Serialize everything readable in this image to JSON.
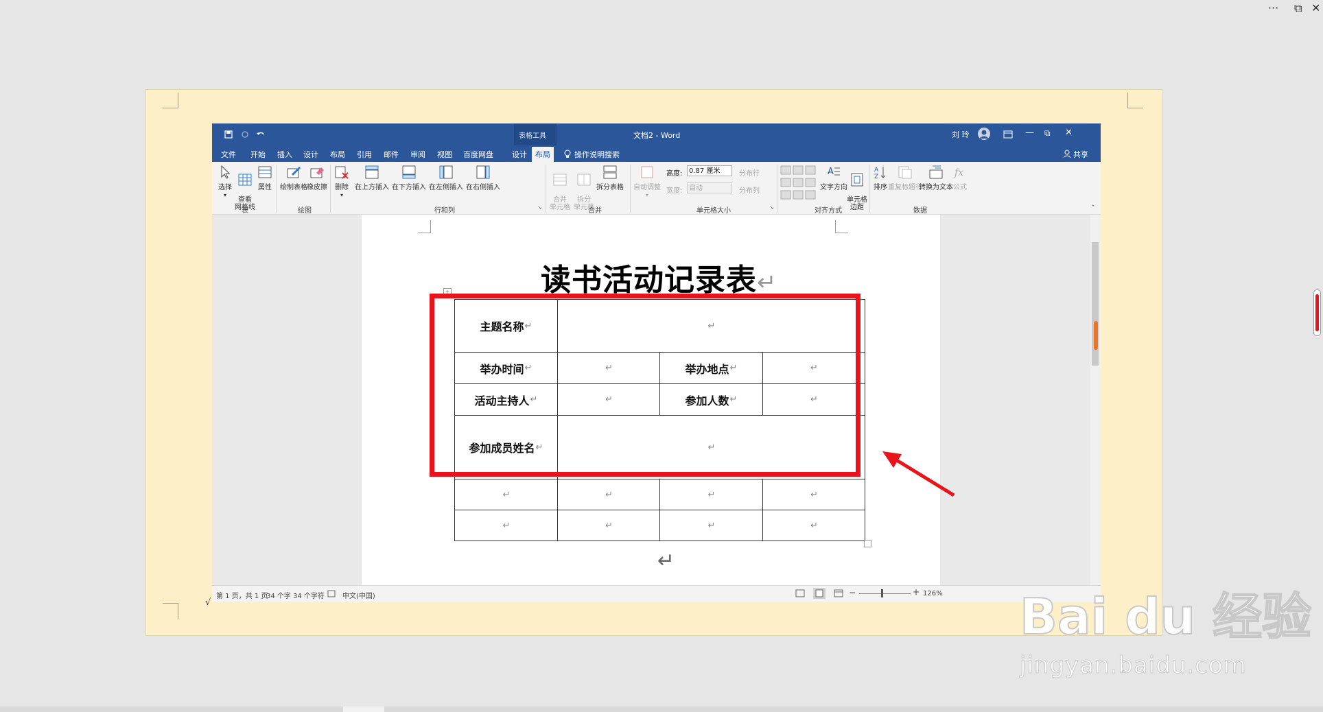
{
  "outer": {
    "more_icon": "···",
    "restore_icon": "⧉",
    "close_icon": "✕"
  },
  "titlebar": {
    "table_tools": "表格工具",
    "doc_title": "文档2 - Word",
    "user": "刘 玲",
    "win_min": "—",
    "win_restore": "⧉",
    "win_close": "✕"
  },
  "tabs": [
    "文件",
    "开始",
    "插入",
    "设计",
    "布局",
    "引用",
    "邮件",
    "审阅",
    "视图",
    "百度网盘",
    "设计",
    "布局"
  ],
  "active_tab": "布局",
  "tell_me": "操作说明搜索",
  "share": "共享",
  "ribbon": {
    "table": {
      "select": "选择",
      "gridlines": "查看\n网格线",
      "properties": "属性",
      "label": "表"
    },
    "draw": {
      "draw_table": "绘制表格",
      "eraser": "橡皮擦",
      "label": "绘图"
    },
    "rows_cols": {
      "delete": "删除",
      "insert_above": "在上方插入",
      "insert_below": "在下方插入",
      "insert_left": "在左侧插入",
      "insert_right": "在右侧插入",
      "label": "行和列"
    },
    "merge": {
      "merge_cells": "合并\n单元格",
      "split_cells": "拆分\n单元格",
      "split_table": "拆分表格",
      "label": "合并"
    },
    "cell_size": {
      "autofit": "自动调整",
      "height_label": "高度:",
      "height_value": "0.87 厘米",
      "width_label": "宽度:",
      "width_value": "自动",
      "distribute_rows": "分布行",
      "distribute_cols": "分布列",
      "label": "单元格大小"
    },
    "alignment": {
      "text_direction": "文字方向",
      "cell_margins": "单元格\n边距",
      "label": "对齐方式"
    },
    "data": {
      "sort": "排序",
      "repeat_header": "重复标题行",
      "convert_text": "转换为文本",
      "formula": "公式",
      "label": "数据"
    }
  },
  "document": {
    "heading": "读书活动记录表",
    "para_mark": "↵",
    "table": {
      "r1": {
        "c1": "主题名称"
      },
      "r2": {
        "c1": "举办时间",
        "c3": "举办地点"
      },
      "r3": {
        "c1": "活动主持人",
        "c3": "参加人数"
      },
      "r4": {
        "c1": "参加成员姓名"
      }
    }
  },
  "status": {
    "page": "第 1 页，共 1 页",
    "words": "34 个字",
    "chars": "34 个字符",
    "lang": "中文(中国)",
    "zoom": "126%"
  },
  "watermark": {
    "logo": "Bai  du 经验",
    "url": "jingyan.baidu.com"
  },
  "colors": {
    "word_blue": "#2b579a",
    "highlight_red": "#e8131b",
    "page_yellow": "#fdf0c8"
  }
}
